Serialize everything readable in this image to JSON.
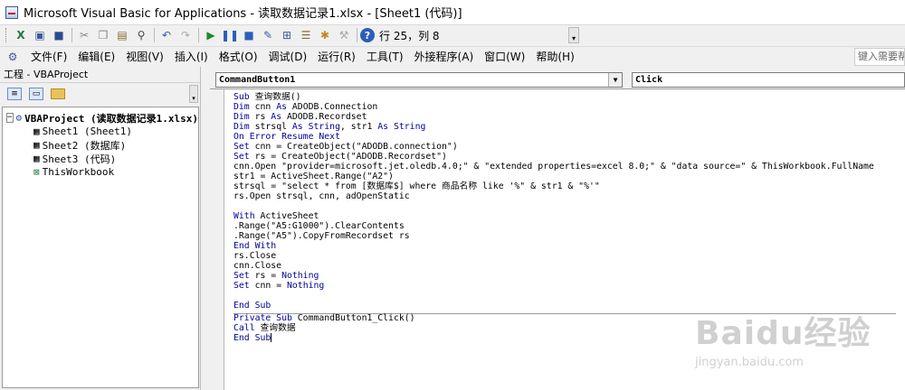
{
  "window": {
    "title": "Microsoft Visual Basic for Applications - 读取数据记录1.xlsx - [Sheet1 (代码)]"
  },
  "toolbar": {
    "status": "行 25，列 8",
    "buttons": [
      "excel-icon",
      "insert-userform-icon",
      "save-icon",
      "cut-icon",
      "copy-icon",
      "paste-icon",
      "find-icon",
      "undo-icon",
      "redo-icon",
      "run-icon",
      "break-icon",
      "reset-icon",
      "design-mode-icon",
      "project-explorer-icon",
      "properties-icon",
      "object-browser-icon",
      "toolbox-icon",
      "help-icon"
    ]
  },
  "menubar": {
    "items": [
      "文件(F)",
      "编辑(E)",
      "视图(V)",
      "插入(I)",
      "格式(O)",
      "调试(D)",
      "运行(R)",
      "工具(T)",
      "外接程序(A)",
      "窗口(W)",
      "帮助(H)"
    ],
    "help_search": "键入需要帮"
  },
  "project_pane": {
    "title": "工程 - VBAProject",
    "root": {
      "toggle": "−",
      "label": "VBAProject (读取数据记录1.xlsx)"
    },
    "items": [
      {
        "label": "Sheet1 (Sheet1)",
        "icon": "sheet-icon"
      },
      {
        "label": "Sheet2 (数据库)",
        "icon": "sheet-icon"
      },
      {
        "label": "Sheet3 (代码)",
        "icon": "sheet-icon"
      },
      {
        "label": "ThisWorkbook",
        "icon": "workbook-icon"
      }
    ]
  },
  "code_window": {
    "object_combo": "CommandButton1",
    "procedure_combo": "Click",
    "lines": [
      "Sub 查询数据()",
      "Dim cnn As ADODB.Connection",
      "Dim rs As ADODB.Recordset",
      "Dim strsql As String, str1 As String",
      "On Error Resume Next",
      "Set cnn = CreateObject(\"ADODB.connection\")",
      "Set rs = CreateObject(\"ADODB.Recordset\")",
      "cnn.Open \"provider=microsoft.jet.oledb.4.0;\" & \"extended properties=excel 8.0;\" & \"data source=\" & ThisWorkbook.FullName",
      "str1 = ActiveSheet.Range(\"A2\")",
      "strsql = \"select * from [数据库$] where 商品名称 like '%\" & str1 & \"%'\"",
      "rs.Open strsql, cnn, adOpenStatic",
      "",
      "With ActiveSheet",
      ".Range(\"A5:G1000\").ClearContents",
      ".Range(\"A5\").CopyFromRecordset rs",
      "End With",
      "rs.Close",
      "cnn.Close",
      "Set rs = Nothing",
      "Set cnn = Nothing",
      "",
      "End Sub",
      "Private Sub CommandButton1_Click()",
      "Call 查询数据",
      "End Sub"
    ]
  },
  "watermark": {
    "brand": "Baidu经验",
    "url": "jingyan.baidu.com"
  }
}
